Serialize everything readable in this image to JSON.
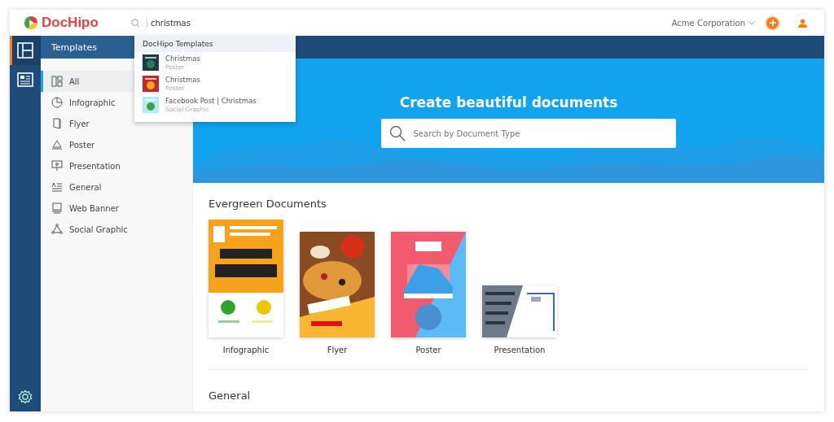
{
  "header": {
    "logo": "DocHipo",
    "search": {
      "value": "christmas"
    },
    "account": "Acme Corporation"
  },
  "rail": [
    {
      "kind": "templates",
      "selected": true
    },
    {
      "kind": "documents",
      "selected": false
    }
  ],
  "sidebar": {
    "title": "Templates",
    "items": [
      {
        "label": "All",
        "selected": true
      },
      {
        "label": "Infographic",
        "selected": false
      },
      {
        "label": "Flyer",
        "selected": false
      },
      {
        "label": "Poster",
        "selected": false
      },
      {
        "label": "Presentation",
        "selected": false
      },
      {
        "label": "General",
        "selected": false
      },
      {
        "label": "Web Banner",
        "selected": false
      },
      {
        "label": "Social Graphic",
        "selected": false
      }
    ]
  },
  "dropdown": {
    "heading": "DocHipo Templates",
    "items": [
      {
        "title": "Christmas",
        "subtitle": "Poster"
      },
      {
        "title": "Christmas",
        "subtitle": "Poster"
      },
      {
        "title": "Facebook Post | Christmas",
        "subtitle": "Social Graphic"
      }
    ]
  },
  "hero": {
    "title": "Create beautiful documents",
    "search": {
      "placeholder": "Search by Document Type"
    }
  },
  "sections": [
    {
      "title": "Evergreen Documents",
      "docs": [
        {
          "label": "Infographic",
          "kind": "picture"
        },
        {
          "label": "Flyer",
          "kind": "picture"
        },
        {
          "label": "Poster",
          "kind": "picture"
        },
        {
          "label": "Presentation",
          "kind": "picture"
        }
      ]
    },
    {
      "title": "General"
    }
  ]
}
